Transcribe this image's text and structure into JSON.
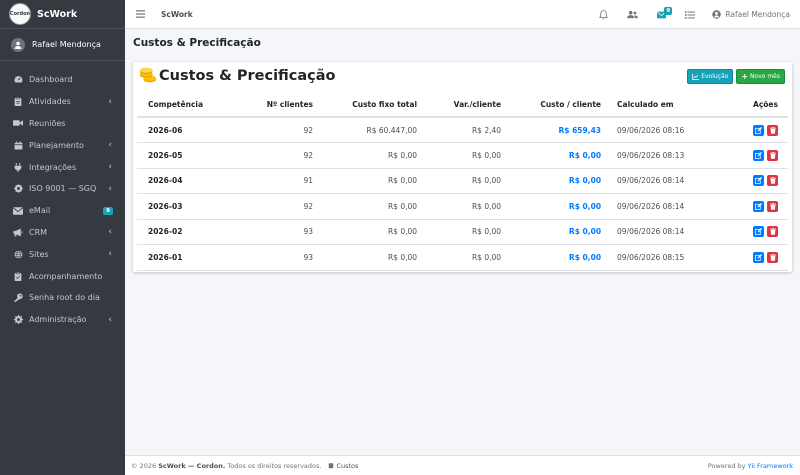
{
  "brand": {
    "logo_text": "Cordon",
    "name": "ScWork"
  },
  "user": {
    "name": "Rafael Mendonça"
  },
  "sidebar": {
    "items": [
      {
        "label": "Dashboard",
        "icon": "dashboard-icon",
        "chevron": false
      },
      {
        "label": "Atividades",
        "icon": "clipboard-icon",
        "chevron": true
      },
      {
        "label": "Reuniões",
        "icon": "video-icon",
        "chevron": false
      },
      {
        "label": "Planejamento",
        "icon": "calendar-icon",
        "chevron": true
      },
      {
        "label": "Integrações",
        "icon": "plug-icon",
        "chevron": true
      },
      {
        "label": "ISO 9001 — SGQ",
        "icon": "certificate-icon",
        "chevron": true
      },
      {
        "label": "eMail",
        "icon": "envelope-icon",
        "chevron": false,
        "badge": "9"
      },
      {
        "label": "CRM",
        "icon": "megaphone-icon",
        "chevron": true
      },
      {
        "label": "Sites",
        "icon": "globe-icon",
        "chevron": true
      },
      {
        "label": "Acompanhamento",
        "icon": "clipboard-check-icon",
        "chevron": false
      },
      {
        "label": "Senha root do dia",
        "icon": "key-icon",
        "chevron": false
      },
      {
        "label": "Administração",
        "icon": "cog-icon",
        "chevron": true
      }
    ]
  },
  "topbar": {
    "brand": "ScWork",
    "mail_badge": "9",
    "user_name": "Rafael Mendonça"
  },
  "page": {
    "header": "Custos & Precificação",
    "card_title": "Custos & Precificação"
  },
  "buttons": {
    "evolucao": "Evolução",
    "novo_mes": "Novo mês"
  },
  "table": {
    "headers": {
      "competencia": "Competência",
      "clientes": "Nº clientes",
      "custo_fixo": "Custo fixo total",
      "var_cliente": "Var./cliente",
      "custo_cliente": "Custo / cliente",
      "calculado": "Calculado em",
      "acoes": "Ações"
    },
    "rows": [
      {
        "competencia": "2026-06",
        "clientes": "92",
        "custo_fixo": "R$ 60.447,00",
        "var_cliente": "R$ 2,40",
        "custo_cliente": "R$ 659,43",
        "calculado": "09/06/2026 08:16"
      },
      {
        "competencia": "2026-05",
        "clientes": "92",
        "custo_fixo": "R$ 0,00",
        "var_cliente": "R$ 0,00",
        "custo_cliente": "R$ 0,00",
        "calculado": "09/06/2026 08:13"
      },
      {
        "competencia": "2026-04",
        "clientes": "91",
        "custo_fixo": "R$ 0,00",
        "var_cliente": "R$ 0,00",
        "custo_cliente": "R$ 0,00",
        "calculado": "09/06/2026 08:14"
      },
      {
        "competencia": "2026-03",
        "clientes": "92",
        "custo_fixo": "R$ 0,00",
        "var_cliente": "R$ 0,00",
        "custo_cliente": "R$ 0,00",
        "calculado": "09/06/2026 08:14"
      },
      {
        "competencia": "2026-02",
        "clientes": "93",
        "custo_fixo": "R$ 0,00",
        "var_cliente": "R$ 0,00",
        "custo_cliente": "R$ 0,00",
        "calculado": "09/06/2026 08:14"
      },
      {
        "competencia": "2026-01",
        "clientes": "93",
        "custo_fixo": "R$ 0,00",
        "var_cliente": "R$ 0,00",
        "custo_cliente": "R$ 0,00",
        "calculado": "09/06/2026 08:15"
      }
    ]
  },
  "footer": {
    "copyright": "© 2026",
    "app": "ScWork — Cordon.",
    "rights": "Todos os direitos reservados.",
    "link": "Custos",
    "powered_prefix": "Powered by",
    "framework": "Yii Framework"
  },
  "colors": {
    "sidebar_bg": "#343a40",
    "accent": "#007bff",
    "info": "#17a2b8",
    "success": "#28a745",
    "danger": "#dc3545"
  }
}
